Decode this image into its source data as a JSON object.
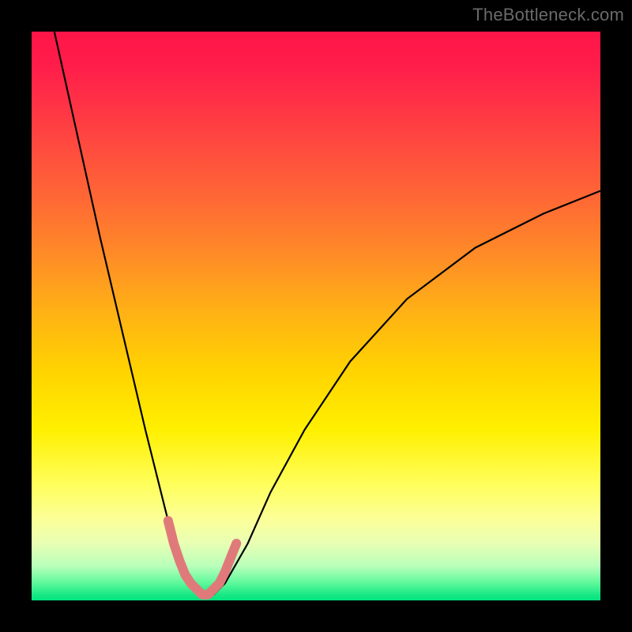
{
  "watermark": "TheBottleneck.com",
  "chart_data": {
    "type": "line",
    "title": "",
    "xlabel": "",
    "ylabel": "",
    "xlim": [
      0,
      100
    ],
    "ylim": [
      0,
      100
    ],
    "grid": false,
    "legend": false,
    "series": [
      {
        "name": "bottleneck-curve",
        "x": [
          4,
          8,
          12,
          16,
          20,
          24,
          26,
          28,
          30,
          32,
          34,
          38,
          42,
          48,
          56,
          66,
          78,
          90,
          100
        ],
        "y": [
          100,
          82,
          64,
          47,
          30,
          14,
          7,
          3,
          1,
          1,
          3,
          10,
          19,
          30,
          42,
          53,
          62,
          68,
          72
        ],
        "color": "#000000",
        "width": 2
      },
      {
        "name": "optimum-marker",
        "x": [
          24,
          25,
          26,
          27,
          28,
          29,
          30,
          31,
          32,
          33,
          34,
          35,
          36
        ],
        "y": [
          14,
          10,
          7,
          4.5,
          3,
          2,
          1,
          1,
          2,
          3,
          5,
          7.5,
          10
        ],
        "color": "#e07a7a",
        "width": 11
      }
    ],
    "background_gradient": {
      "orientation": "vertical",
      "stops": [
        {
          "pos": 0.0,
          "color": "#ff1548"
        },
        {
          "pos": 0.5,
          "color": "#ffd400"
        },
        {
          "pos": 0.85,
          "color": "#fbff9a"
        },
        {
          "pos": 1.0,
          "color": "#00e47f"
        }
      ]
    }
  }
}
